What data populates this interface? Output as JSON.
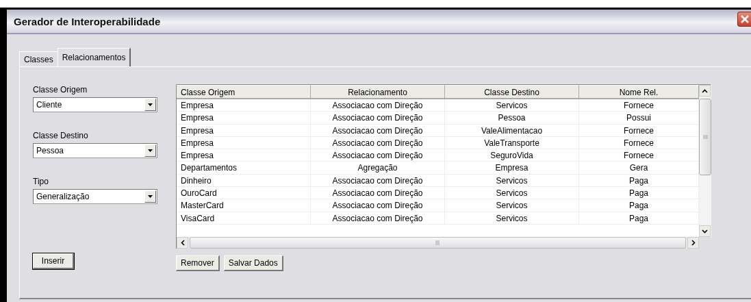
{
  "window": {
    "title": "Gerador de Interoperabilidade"
  },
  "tabs": [
    {
      "label": "Classes",
      "selected": false
    },
    {
      "label": "Relacionamentos",
      "selected": true
    }
  ],
  "form": [
    {
      "label": "Classe Origem",
      "value": "Cliente"
    },
    {
      "label": "Classe Destino",
      "value": "Pessoa"
    },
    {
      "label": "Tipo",
      "value": "Generalização"
    }
  ],
  "insert_button": "Inserir",
  "table": {
    "columns": [
      "Classe Origem",
      "Relacionamento",
      "Classe Destino",
      "Nome Rel."
    ],
    "rows": [
      [
        "Empresa",
        "Associacao com Direção",
        "Servicos",
        "Fornece"
      ],
      [
        "Empresa",
        "Associacao com Direção",
        "Pessoa",
        "Possui"
      ],
      [
        "Empresa",
        "Associacao com Direção",
        "ValeAlimentacao",
        "Fornece"
      ],
      [
        "Empresa",
        "Associacao com Direção",
        "ValeTransporte",
        "Fornece"
      ],
      [
        "Empresa",
        "Associacao com Direção",
        "SeguroVida",
        "Fornece"
      ],
      [
        "Departamentos",
        "Agregação",
        "Empresa",
        "Gera"
      ],
      [
        "Dinheiro",
        "Associacao com Direção",
        "Servicos",
        "Paga"
      ],
      [
        "OuroCard",
        "Associacao com Direção",
        "Servicos",
        "Paga"
      ],
      [
        "MasterCard",
        "Associacao com Direção",
        "Servicos",
        "Paga"
      ],
      [
        "VisaCard",
        "Associacao com Direção",
        "Servicos",
        "Paga"
      ]
    ]
  },
  "buttons": [
    "Remover",
    "Salvar Dados"
  ]
}
